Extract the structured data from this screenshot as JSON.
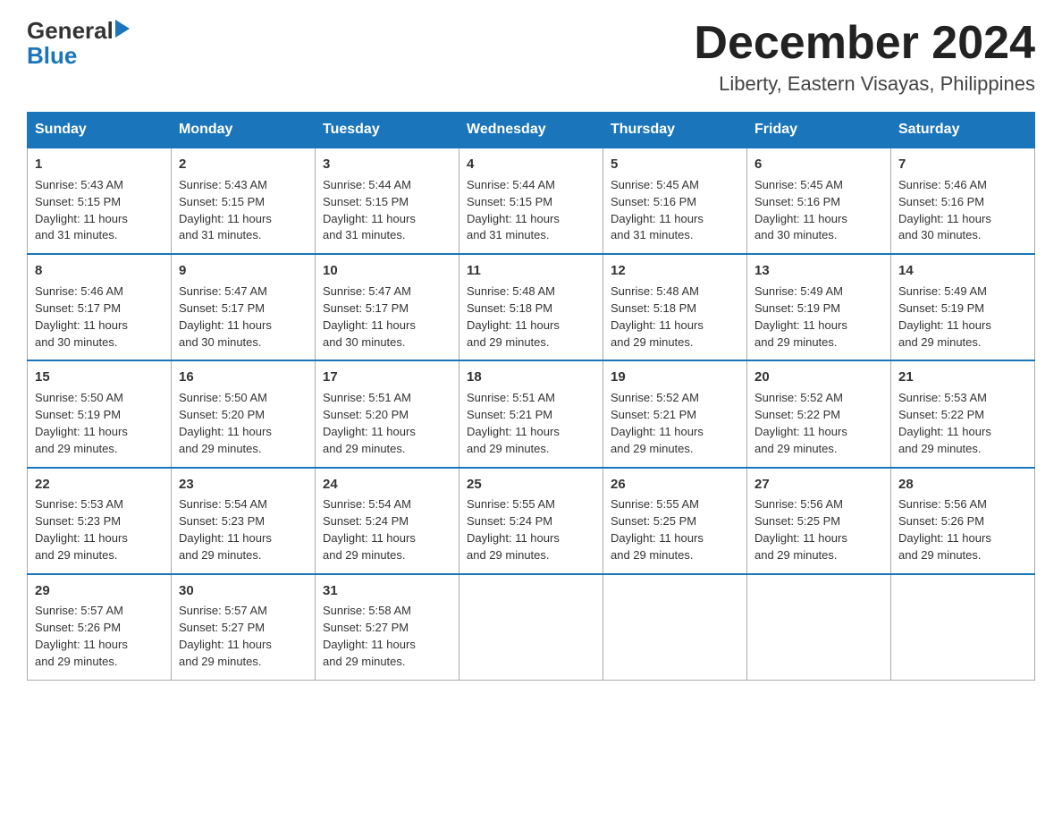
{
  "header": {
    "logo_general": "General",
    "logo_blue": "Blue",
    "main_title": "December 2024",
    "subtitle": "Liberty, Eastern Visayas, Philippines"
  },
  "calendar": {
    "days_of_week": [
      "Sunday",
      "Monday",
      "Tuesday",
      "Wednesday",
      "Thursday",
      "Friday",
      "Saturday"
    ],
    "weeks": [
      [
        {
          "day": "1",
          "sunrise": "5:43 AM",
          "sunset": "5:15 PM",
          "daylight": "11 hours and 31 minutes."
        },
        {
          "day": "2",
          "sunrise": "5:43 AM",
          "sunset": "5:15 PM",
          "daylight": "11 hours and 31 minutes."
        },
        {
          "day": "3",
          "sunrise": "5:44 AM",
          "sunset": "5:15 PM",
          "daylight": "11 hours and 31 minutes."
        },
        {
          "day": "4",
          "sunrise": "5:44 AM",
          "sunset": "5:15 PM",
          "daylight": "11 hours and 31 minutes."
        },
        {
          "day": "5",
          "sunrise": "5:45 AM",
          "sunset": "5:16 PM",
          "daylight": "11 hours and 31 minutes."
        },
        {
          "day": "6",
          "sunrise": "5:45 AM",
          "sunset": "5:16 PM",
          "daylight": "11 hours and 30 minutes."
        },
        {
          "day": "7",
          "sunrise": "5:46 AM",
          "sunset": "5:16 PM",
          "daylight": "11 hours and 30 minutes."
        }
      ],
      [
        {
          "day": "8",
          "sunrise": "5:46 AM",
          "sunset": "5:17 PM",
          "daylight": "11 hours and 30 minutes."
        },
        {
          "day": "9",
          "sunrise": "5:47 AM",
          "sunset": "5:17 PM",
          "daylight": "11 hours and 30 minutes."
        },
        {
          "day": "10",
          "sunrise": "5:47 AM",
          "sunset": "5:17 PM",
          "daylight": "11 hours and 30 minutes."
        },
        {
          "day": "11",
          "sunrise": "5:48 AM",
          "sunset": "5:18 PM",
          "daylight": "11 hours and 29 minutes."
        },
        {
          "day": "12",
          "sunrise": "5:48 AM",
          "sunset": "5:18 PM",
          "daylight": "11 hours and 29 minutes."
        },
        {
          "day": "13",
          "sunrise": "5:49 AM",
          "sunset": "5:19 PM",
          "daylight": "11 hours and 29 minutes."
        },
        {
          "day": "14",
          "sunrise": "5:49 AM",
          "sunset": "5:19 PM",
          "daylight": "11 hours and 29 minutes."
        }
      ],
      [
        {
          "day": "15",
          "sunrise": "5:50 AM",
          "sunset": "5:19 PM",
          "daylight": "11 hours and 29 minutes."
        },
        {
          "day": "16",
          "sunrise": "5:50 AM",
          "sunset": "5:20 PM",
          "daylight": "11 hours and 29 minutes."
        },
        {
          "day": "17",
          "sunrise": "5:51 AM",
          "sunset": "5:20 PM",
          "daylight": "11 hours and 29 minutes."
        },
        {
          "day": "18",
          "sunrise": "5:51 AM",
          "sunset": "5:21 PM",
          "daylight": "11 hours and 29 minutes."
        },
        {
          "day": "19",
          "sunrise": "5:52 AM",
          "sunset": "5:21 PM",
          "daylight": "11 hours and 29 minutes."
        },
        {
          "day": "20",
          "sunrise": "5:52 AM",
          "sunset": "5:22 PM",
          "daylight": "11 hours and 29 minutes."
        },
        {
          "day": "21",
          "sunrise": "5:53 AM",
          "sunset": "5:22 PM",
          "daylight": "11 hours and 29 minutes."
        }
      ],
      [
        {
          "day": "22",
          "sunrise": "5:53 AM",
          "sunset": "5:23 PM",
          "daylight": "11 hours and 29 minutes."
        },
        {
          "day": "23",
          "sunrise": "5:54 AM",
          "sunset": "5:23 PM",
          "daylight": "11 hours and 29 minutes."
        },
        {
          "day": "24",
          "sunrise": "5:54 AM",
          "sunset": "5:24 PM",
          "daylight": "11 hours and 29 minutes."
        },
        {
          "day": "25",
          "sunrise": "5:55 AM",
          "sunset": "5:24 PM",
          "daylight": "11 hours and 29 minutes."
        },
        {
          "day": "26",
          "sunrise": "5:55 AM",
          "sunset": "5:25 PM",
          "daylight": "11 hours and 29 minutes."
        },
        {
          "day": "27",
          "sunrise": "5:56 AM",
          "sunset": "5:25 PM",
          "daylight": "11 hours and 29 minutes."
        },
        {
          "day": "28",
          "sunrise": "5:56 AM",
          "sunset": "5:26 PM",
          "daylight": "11 hours and 29 minutes."
        }
      ],
      [
        {
          "day": "29",
          "sunrise": "5:57 AM",
          "sunset": "5:26 PM",
          "daylight": "11 hours and 29 minutes."
        },
        {
          "day": "30",
          "sunrise": "5:57 AM",
          "sunset": "5:27 PM",
          "daylight": "11 hours and 29 minutes."
        },
        {
          "day": "31",
          "sunrise": "5:58 AM",
          "sunset": "5:27 PM",
          "daylight": "11 hours and 29 minutes."
        },
        null,
        null,
        null,
        null
      ]
    ],
    "sunrise_label": "Sunrise:",
    "sunset_label": "Sunset:",
    "daylight_label": "Daylight:"
  }
}
